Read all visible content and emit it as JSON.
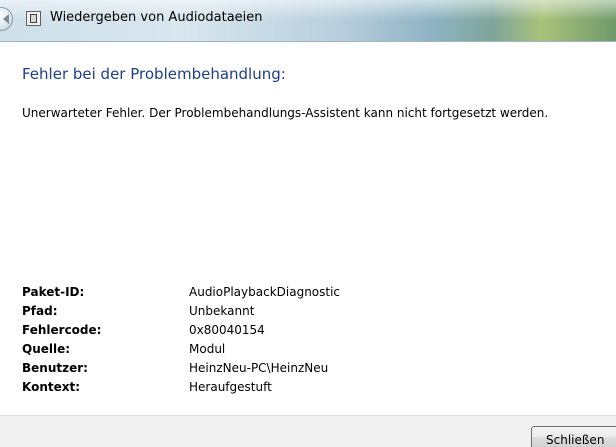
{
  "window": {
    "title": "Wiedergeben von Audiodataeien",
    "icons": {
      "back": "back-arrow-icon",
      "app": "troubleshooter-app-icon"
    }
  },
  "main": {
    "heading": "Fehler bei der Problembehandlung:",
    "message": "Unerwarteter Fehler. Der Problembehandlungs-Assistent kann nicht fortgesetzt werden.",
    "details": [
      {
        "label": "Paket-ID:",
        "value": "AudioPlaybackDiagnostic"
      },
      {
        "label": "Pfad:",
        "value": "Unbekannt"
      },
      {
        "label": "Fehlercode:",
        "value": "0x80040154"
      },
      {
        "label": "Quelle:",
        "value": "Modul"
      },
      {
        "label": "Benutzer:",
        "value": "HeinzNeu-PC\\HeinzNeu"
      },
      {
        "label": "Kontext:",
        "value": "Heraufgestuft"
      }
    ]
  },
  "footer": {
    "close_label": "Schließen"
  },
  "colors": {
    "heading": "#1e3e8c",
    "footer_bg": "#f0f0f0"
  }
}
